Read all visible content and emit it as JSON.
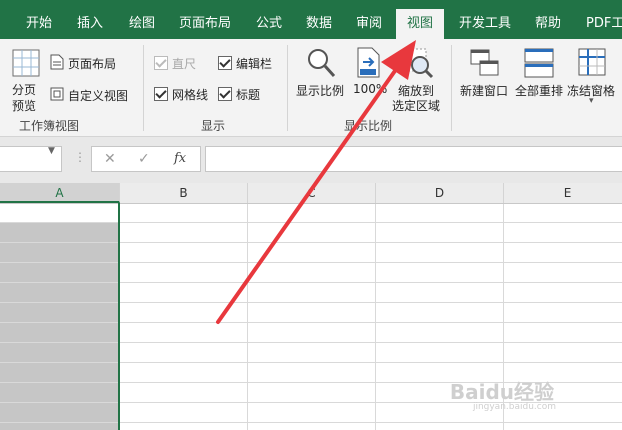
{
  "tabs": [
    {
      "label": "开始"
    },
    {
      "label": "插入"
    },
    {
      "label": "绘图"
    },
    {
      "label": "页面布局"
    },
    {
      "label": "公式"
    },
    {
      "label": "数据"
    },
    {
      "label": "审阅"
    },
    {
      "label": "视图"
    },
    {
      "label": "开发工具"
    },
    {
      "label": "帮助"
    },
    {
      "label": "PDF工具"
    }
  ],
  "active_tab": "视图",
  "ribbon": {
    "workbook_views": {
      "page_break_preview": "分页\n预览",
      "page_break_line1": "分页",
      "page_break_line2": "预览",
      "page_layout": "页面布局",
      "custom_views": "自定义视图",
      "group_label": "工作簿视图"
    },
    "show": {
      "ruler": "直尺",
      "gridlines": "网格线",
      "formula_bar": "编辑栏",
      "headings": "标题",
      "group_label": "显示"
    },
    "zoom": {
      "zoom": "显示比例",
      "zoom_100": "100%",
      "zoom_to_selection_line1": "缩放到",
      "zoom_to_selection_line2": "选定区域",
      "group_label": "显示比例"
    },
    "window": {
      "new_window": "新建窗口",
      "arrange_all": "全部重排",
      "freeze_panes": "冻结窗格"
    }
  },
  "formula_bar": {
    "cancel": "✕",
    "enter": "✓",
    "fx": "fx",
    "more": "⋮"
  },
  "columns": [
    "A",
    "B",
    "C",
    "D",
    "E"
  ],
  "selected_column": "A",
  "watermark": {
    "main": "Baidu经验",
    "sub": "jingyan.baidu.com"
  },
  "colors": {
    "ribbon_green": "#217346",
    "arrow_red": "#e8383d"
  }
}
